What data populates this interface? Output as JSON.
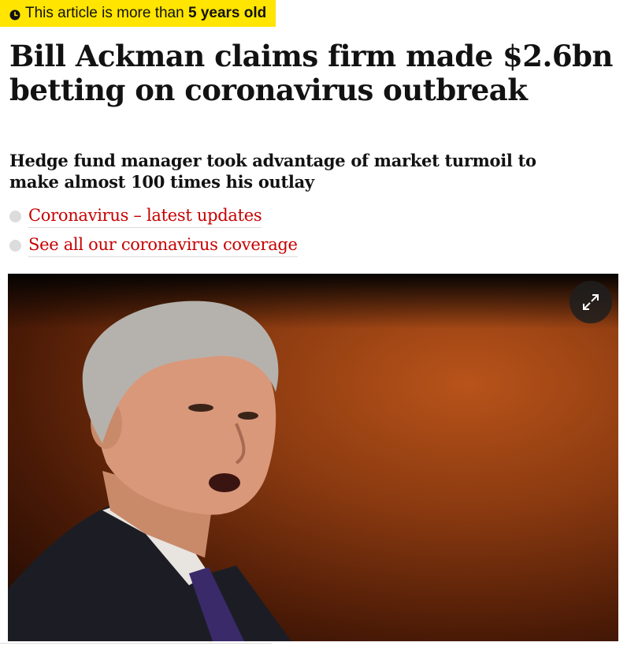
{
  "badge": {
    "icon": "clock-icon",
    "text_prefix": "This article is more than ",
    "text_bold": "5 years old",
    "background": "#ffe500"
  },
  "headline": "Bill Ackman claims firm made $2.6bn betting on coronavirus outbreak",
  "standfirst": "Hedge fund manager took advantage of market turmoil to make almost 100 times his outlay",
  "links": [
    {
      "label": "Coronavirus – latest updates"
    },
    {
      "label": "See all our coronavirus coverage"
    }
  ],
  "colors": {
    "link": "#c70000",
    "text": "#121212"
  },
  "image": {
    "expand_icon": "expand-icon"
  }
}
